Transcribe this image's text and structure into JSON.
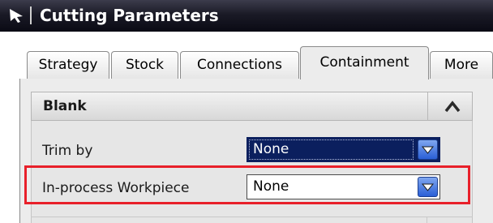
{
  "window": {
    "title": "Cutting Parameters",
    "icon": "arrow-cursor-icon"
  },
  "tabs": [
    {
      "label": "Strategy",
      "active": false
    },
    {
      "label": "Stock",
      "active": false
    },
    {
      "label": "Connections",
      "active": false
    },
    {
      "label": "Containment",
      "active": true
    },
    {
      "label": "More",
      "active": false
    }
  ],
  "section": {
    "title": "Blank",
    "collapse_icon": "chevron-up-icon"
  },
  "fields": {
    "trim_by": {
      "label": "Trim by",
      "value": "None",
      "selected": true
    },
    "in_process_workpiece": {
      "label": "In-process Workpiece",
      "value": "None",
      "selected": false
    }
  },
  "colors": {
    "highlight": "#e8202a",
    "selected_bg": "#0b1f5e",
    "dropdown_button": "#2a5fd6"
  }
}
